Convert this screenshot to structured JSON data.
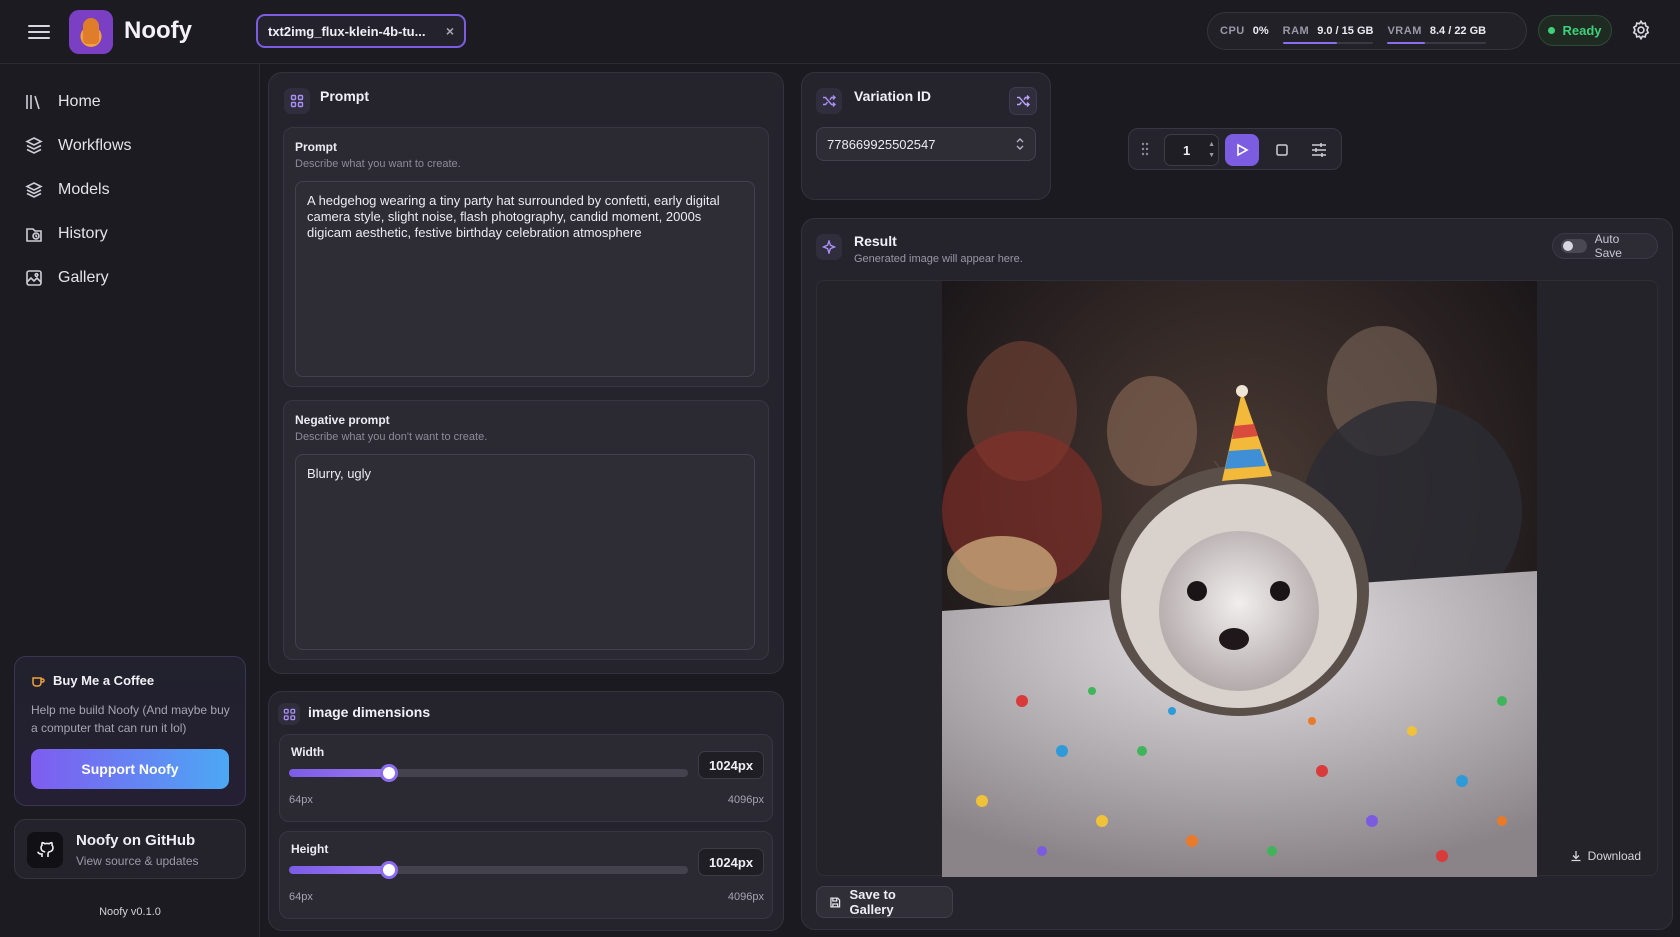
{
  "app": {
    "name": "Noofy",
    "version": "Noofy v0.1.0"
  },
  "tab": {
    "label": "txt2img_flux-klein-4b-tu...",
    "close": "×"
  },
  "stats": [
    {
      "key": "CPU",
      "value": "0%",
      "level": 0
    },
    {
      "key": "RAM",
      "value": "9.0 / 15 GB",
      "level": 0.6
    },
    {
      "key": "VRAM",
      "value": "8.4 / 22 GB",
      "level": 0.38
    }
  ],
  "status": "Ready",
  "sidebar": {
    "items": [
      {
        "label": "Home",
        "icon": "library-icon"
      },
      {
        "label": "Workflows",
        "icon": "workflows-icon"
      },
      {
        "label": "Models",
        "icon": "layers-icon"
      },
      {
        "label": "History",
        "icon": "history-icon"
      },
      {
        "label": "Gallery",
        "icon": "gallery-icon"
      }
    ],
    "coffee": {
      "title": "Buy Me a Coffee",
      "desc": "Help me build Noofy (And maybe buy a computer that can run it lol)",
      "button": "Support Noofy"
    },
    "github": {
      "title": "Noofy on GitHub",
      "subtitle": "View source & updates"
    }
  },
  "prompt_panel": {
    "title": "Prompt",
    "prompt": {
      "label": "Prompt",
      "hint": "Describe what you want to create.",
      "value": "A hedgehog wearing a tiny party hat surrounded by confetti, early digital camera style, slight noise, flash photography, candid moment, 2000s digicam aesthetic, festive birthday celebration atmosphere"
    },
    "negative": {
      "label": "Negative prompt",
      "hint": "Describe what you don't want to create.",
      "value": "Blurry, ugly"
    }
  },
  "dimensions": {
    "title": "image dimensions",
    "width": {
      "label": "Width",
      "value": "1024px",
      "min": "64px",
      "max": "4096px",
      "fraction": 0.25
    },
    "height": {
      "label": "Height",
      "value": "1024px",
      "min": "64px",
      "max": "4096px",
      "fraction": 0.25
    }
  },
  "variation": {
    "title": "Variation ID",
    "value": "778669925502547"
  },
  "run": {
    "count": "1"
  },
  "result": {
    "title": "Result",
    "subtitle": "Generated image will appear here.",
    "autosave": "Auto Save",
    "download": "Download",
    "save": "Save to Gallery"
  },
  "colors": {
    "accent": "#7c5ce0",
    "ready": "#3ed07a",
    "background": "#1b1a20"
  }
}
